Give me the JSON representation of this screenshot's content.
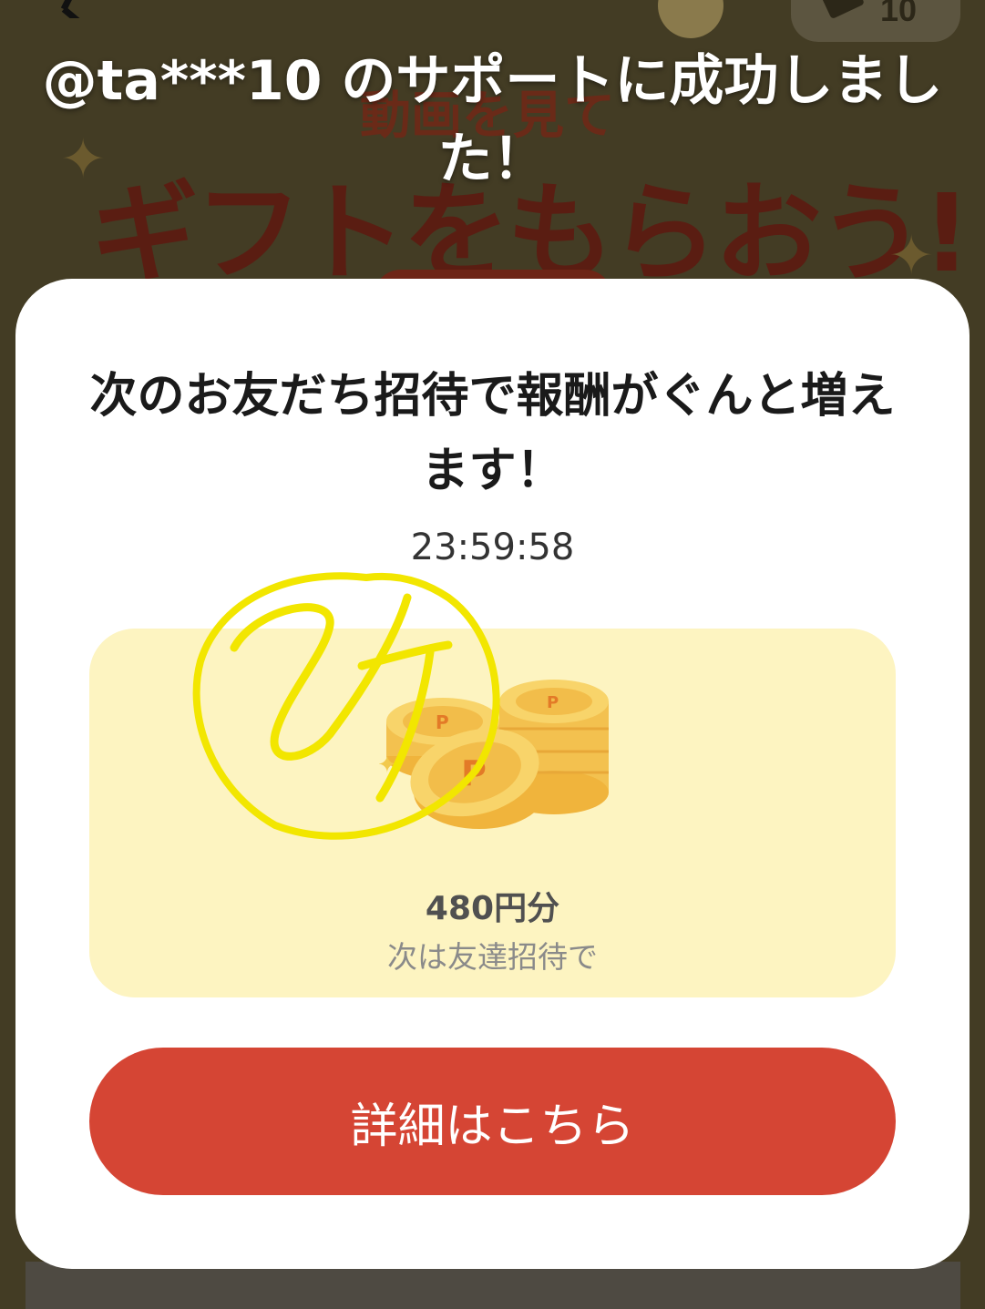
{
  "background": {
    "heading_small": "動画を見て",
    "heading_large": "ギフトをもらおう!",
    "badge_count": "10",
    "icons": [
      "back-arrow-icon",
      "avatar",
      "ticket-icon",
      "sparkle-icon"
    ]
  },
  "toast": {
    "message": "@ta***10 のサポートに成功しました！"
  },
  "modal": {
    "title": "次のお友だち招待で報酬がぐんと増えます！",
    "timer": "23:59:58",
    "reward": {
      "amount": "480円分",
      "caption": "次は友達招待で",
      "icon": "coins-icon"
    },
    "button_label": "詳細はこちら"
  },
  "colors": {
    "overlay": "#433c24",
    "card_background": "#fdf4c1",
    "button": "#d54534",
    "scribble": "#f2e600"
  }
}
